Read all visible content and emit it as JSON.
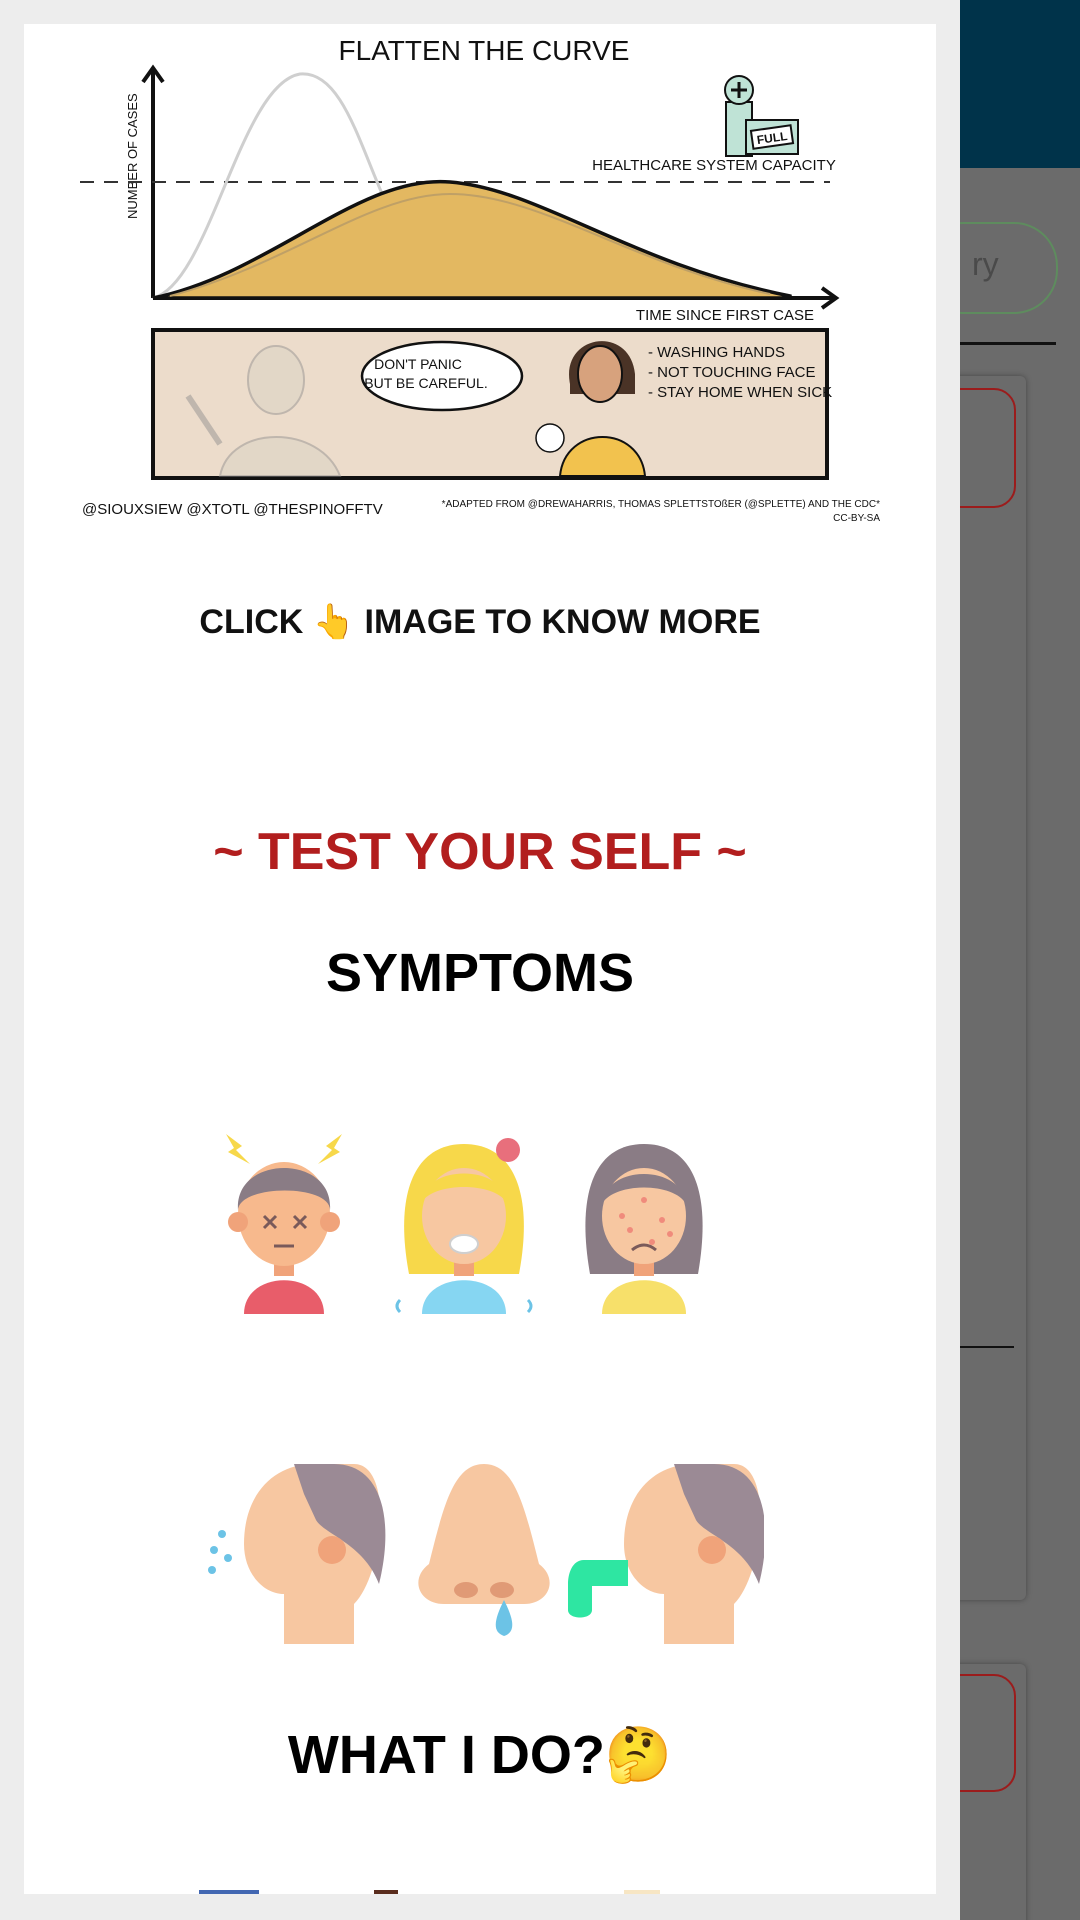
{
  "infographic": {
    "title": "FLATTEN THE CURVE",
    "ylabel": "NUMBER OF CASES",
    "xlabel": "TIME SINCE FIRST CASE",
    "capacity_label": "HEALTHCARE SYSTEM CAPACITY",
    "hospital_sign": "FULL",
    "speech_line1": "DON'T PANIC",
    "speech_line2": "BUT BE CAREFUL.",
    "tips": [
      "- WASHING HANDS",
      "- NOT TOUCHING FACE",
      "- STAY HOME WHEN SICK"
    ],
    "credits_left": "@SIOUXSIEW @XTOTL @THESPINOFFTV",
    "credits_right": "*ADAPTED FROM @DREWAHARRIS, THOMAS SPLETTSTOßER (@SPLETTE) AND THE CDC*",
    "license": "CC-BY-SA"
  },
  "click_hint": "CLICK 👆 IMAGE TO KNOW MORE",
  "test_title": "~ TEST YOUR SELF ~",
  "symptoms_title": "SYMPTOMS",
  "symptom_icons_row1": [
    "headache-icon",
    "fever-sweat-icon",
    "rash-icon"
  ],
  "symptom_icons_row2": [
    "cough-icon",
    "runny-nose-icon",
    "vomiting-icon"
  ],
  "what_title": "WHAT I DO?🤔",
  "background": {
    "pill_text": "ry"
  },
  "colors": {
    "accent_red": "#b21e1e",
    "header_dark": "#00334a",
    "curve_fill": "#e3b861"
  }
}
